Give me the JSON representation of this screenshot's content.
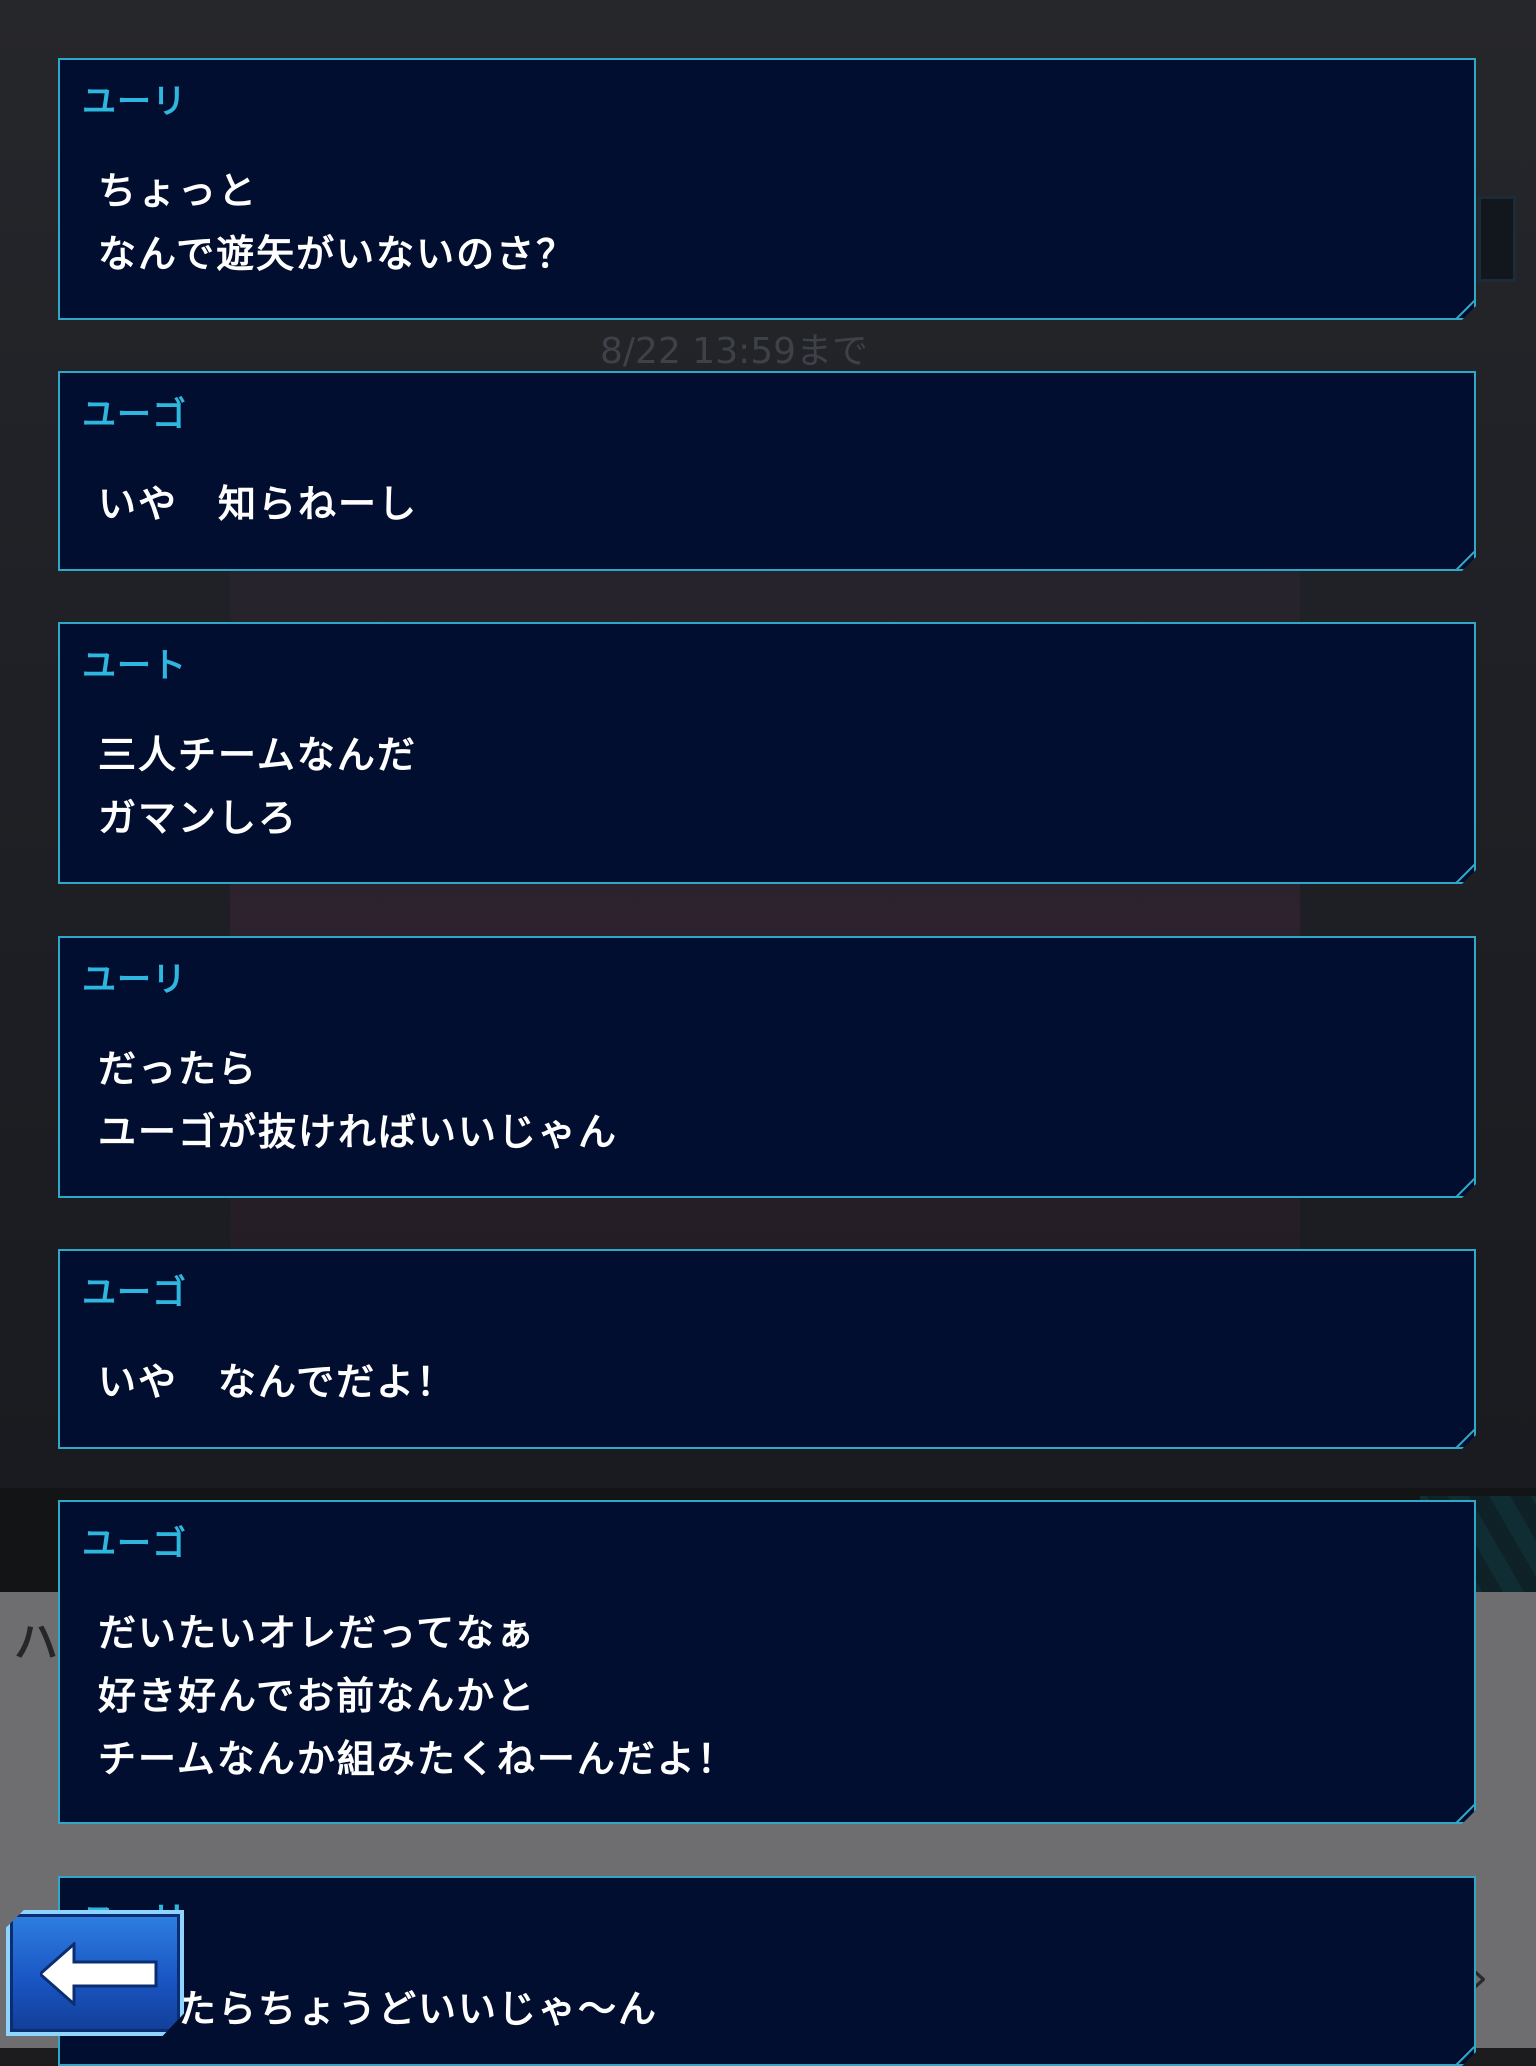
{
  "background": {
    "event_timer": "8/22 13:59まで",
    "hidden_label": "ハ"
  },
  "dialogue": [
    {
      "speaker": "ユーリ",
      "lines": [
        "ちょっと",
        "なんで遊矢がいないのさ？"
      ]
    },
    {
      "speaker": "ユーゴ",
      "lines": [
        "いや　知らねーし"
      ]
    },
    {
      "speaker": "ユート",
      "lines": [
        "三人チームなんだ",
        "ガマンしろ"
      ]
    },
    {
      "speaker": "ユーリ",
      "lines": [
        "だったら",
        "ユーゴが抜ければいいじゃん"
      ]
    },
    {
      "speaker": "ユーゴ",
      "lines": [
        "いや　なんでだよ！"
      ]
    },
    {
      "speaker": "ユーゴ",
      "lines": [
        "だいたいオレだってなぁ",
        "好き好んでお前なんかと",
        "チームなんか組みたくねーんだよ！"
      ]
    },
    {
      "speaker": "ユーリ",
      "lines": [
        "だったらちょうどいいじゃ～ん"
      ]
    }
  ],
  "colors": {
    "card_bg": "#020e30",
    "card_border": "#2fa7c6",
    "speaker": "#2fb6de",
    "text": "#ffffff",
    "back_button": "#1a56c4"
  },
  "icons": {
    "back": "left-arrow-icon"
  }
}
